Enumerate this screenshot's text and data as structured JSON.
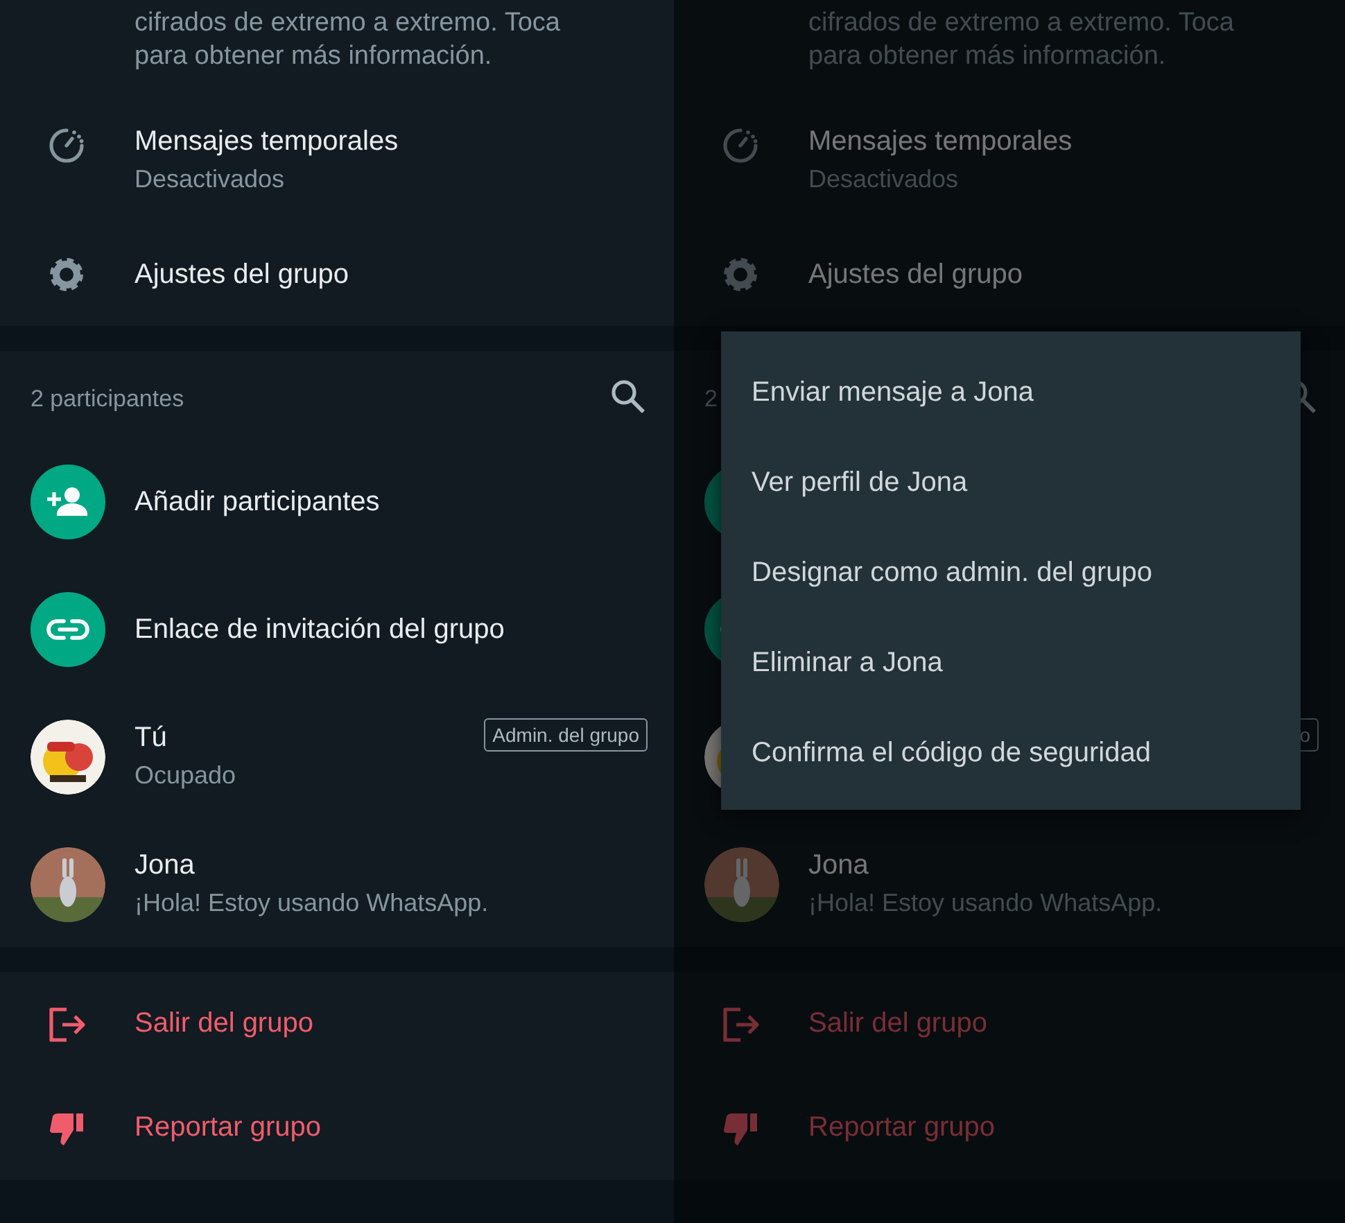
{
  "screens": [
    {
      "encryption_note": "cifrados de extremo a extremo. Toca para obtener más información.",
      "settings": [
        {
          "title": "Mensajes temporales",
          "subtitle": "Desactivados"
        },
        {
          "title": "Ajustes del grupo"
        }
      ],
      "participants_header": "2 participantes",
      "actions": [
        {
          "label": "Añadir participantes"
        },
        {
          "label": "Enlace de invitación del grupo"
        }
      ],
      "members": [
        {
          "name": "Tú",
          "status": "Ocupado",
          "badge": "Admin. del grupo"
        },
        {
          "name": "Jona",
          "status": "¡Hola! Estoy usando WhatsApp."
        }
      ],
      "danger_actions": [
        {
          "label": "Salir del grupo"
        },
        {
          "label": "Reportar grupo"
        }
      ]
    },
    {
      "dimmed": true,
      "encryption_note": "cifrados de extremo a extremo. Toca para obtener más información.",
      "settings": [
        {
          "title": "Mensajes temporales",
          "subtitle": "Desactivados"
        },
        {
          "title": "Ajustes del grupo"
        }
      ],
      "participants_header": "2",
      "members": [
        {
          "badge": "o"
        },
        {
          "name": "Jona",
          "status": "¡Hola! Estoy usando WhatsApp."
        }
      ],
      "danger_actions": [
        {
          "label": "Salir del grupo"
        },
        {
          "label": "Reportar grupo"
        }
      ],
      "popup_menu": [
        "Enviar mensaje a Jona",
        "Ver perfil de Jona",
        "Designar como admin. del grupo",
        "Eliminar a Jona",
        "Confirma el código de seguridad"
      ]
    }
  ]
}
